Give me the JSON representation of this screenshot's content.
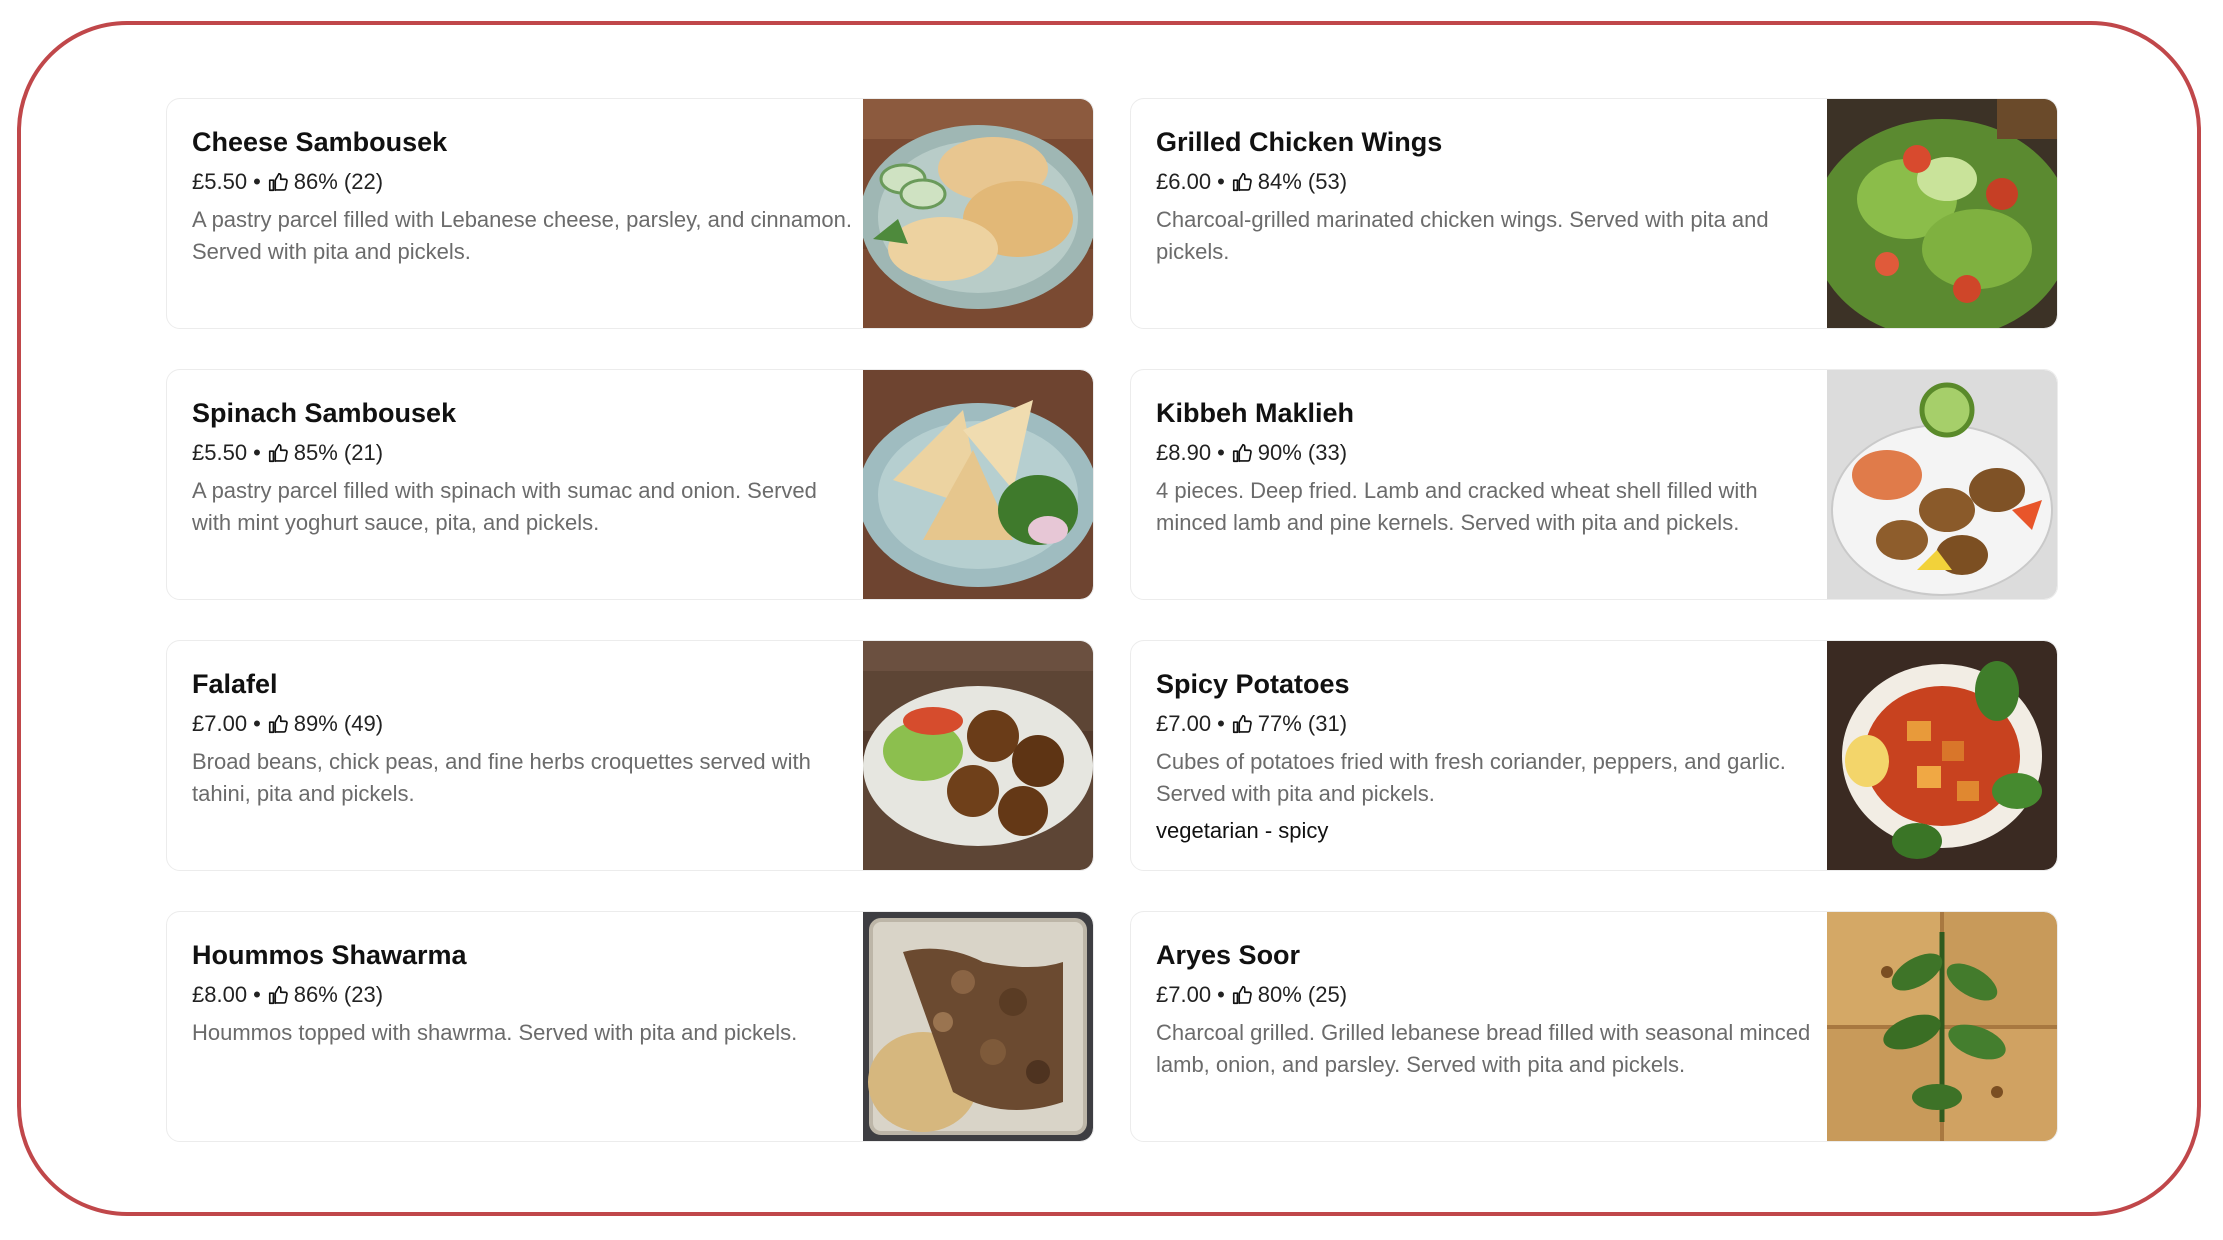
{
  "items": [
    {
      "name": "Cheese Sambousek",
      "price": "£5.50",
      "rating": "86% (22)",
      "description": "A pastry parcel filled with Lebanese cheese, parsley, and cinnamon. Served with pita and pickels.",
      "tags": ""
    },
    {
      "name": "Grilled Chicken Wings",
      "price": "£6.00",
      "rating": "84% (53)",
      "description": "Charcoal-grilled marinated chicken wings. Served with pita and pickels.",
      "tags": ""
    },
    {
      "name": "Spinach Sambousek",
      "price": "£5.50",
      "rating": "85% (21)",
      "description": "A pastry parcel filled with spinach with sumac and onion. Served with mint yoghurt sauce, pita, and pickels.",
      "tags": ""
    },
    {
      "name": "Kibbeh Maklieh",
      "price": "£8.90",
      "rating": "90% (33)",
      "description": "4 pieces. Deep fried. Lamb and cracked wheat shell filled with minced lamb and pine kernels. Served with pita and pickels.",
      "tags": ""
    },
    {
      "name": "Falafel",
      "price": "£7.00",
      "rating": "89% (49)",
      "description": "Broad beans, chick peas, and fine herbs croquettes served with tahini, pita and pickels.",
      "tags": ""
    },
    {
      "name": "Spicy Potatoes",
      "price": "£7.00",
      "rating": "77% (31)",
      "description": "Cubes of potatoes fried with fresh coriander, peppers, and garlic. Served with pita and pickels.",
      "tags": "vegetarian - spicy"
    },
    {
      "name": "Hoummos Shawarma",
      "price": "£8.00",
      "rating": "86% (23)",
      "description": "Hoummos topped with shawrma. Served with pita and pickels.",
      "tags": ""
    },
    {
      "name": "Aryes Soor",
      "price": "£7.00",
      "rating": "80% (25)",
      "description": "Charcoal grilled. Grilled lebanese bread filled with seasonal minced lamb, onion, and parsley. Served with pita and pickels.",
      "tags": ""
    }
  ],
  "separator": "•",
  "colors": {
    "frame_border": "#c0474a",
    "description_text": "#6b6b6b",
    "card_border": "#ececec"
  },
  "icons": {
    "rating": "thumbs-up-icon"
  }
}
